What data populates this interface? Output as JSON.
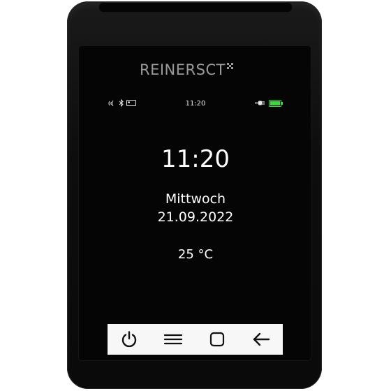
{
  "device": {
    "brand": "REINERSCT"
  },
  "status_bar": {
    "time": "11:20",
    "icons_left": [
      "nfc-waves-icon",
      "bluetooth-icon",
      "card-icon"
    ],
    "icons_right": [
      "power-plug-icon",
      "battery-full-icon"
    ],
    "battery_level": 1.0,
    "battery_color": "#3dd63d"
  },
  "home": {
    "clock": "11:20",
    "weekday": "Mittwoch",
    "date": "21.09.2022",
    "temperature": "25 °C"
  },
  "navbar": {
    "buttons": [
      "power-icon",
      "menu-icon",
      "square-icon",
      "back-arrow-icon"
    ]
  },
  "colors": {
    "screen_bg": "#050505",
    "text": "#ffffff",
    "navbar_bg": "#f7f7f7",
    "brand_text": "#9a9a9a"
  }
}
